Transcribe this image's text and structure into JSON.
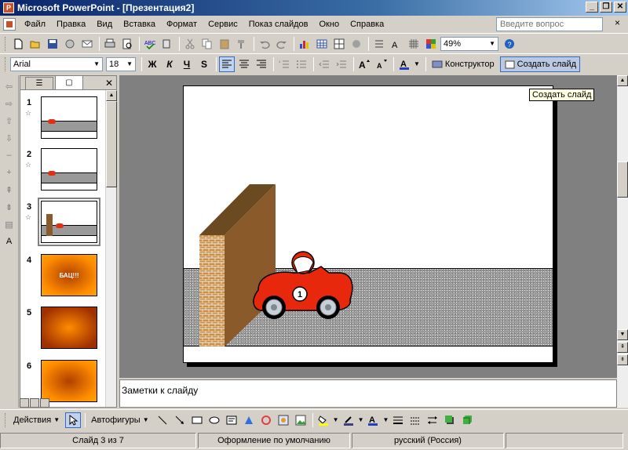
{
  "window": {
    "title": "Microsoft PowerPoint - [Презентация2]",
    "minimize": "_",
    "restore": "❐",
    "close": "✕"
  },
  "menu": {
    "items": [
      "Файл",
      "Правка",
      "Вид",
      "Вставка",
      "Формат",
      "Сервис",
      "Показ слайдов",
      "Окно",
      "Справка"
    ],
    "help_placeholder": "Введите вопрос",
    "close_doc": "×"
  },
  "standard_toolbar": {
    "zoom": "49%"
  },
  "formatting_toolbar": {
    "font": "Arial",
    "size": "18",
    "bold": "Ж",
    "italic": "К",
    "underline": "Ч",
    "shadow": "S",
    "designer": "Конструктор",
    "new_slide": "Создать слайд"
  },
  "tooltip": "Создать слайд",
  "slides": [
    {
      "number": "1",
      "kind": "road-car"
    },
    {
      "number": "2",
      "kind": "road-car"
    },
    {
      "number": "3",
      "kind": "road-wall"
    },
    {
      "number": "4",
      "kind": "orange",
      "title": "БАЦ!!!"
    },
    {
      "number": "5",
      "kind": "orange2"
    },
    {
      "number": "6",
      "kind": "orange"
    }
  ],
  "car_number": "1",
  "notes_placeholder": "Заметки к слайду",
  "drawing_toolbar": {
    "actions": "Действия",
    "autoshapes": "Автофигуры"
  },
  "status": {
    "slide": "Слайд 3 из 7",
    "design": "Оформление по умолчанию",
    "language": "русский (Россия)"
  },
  "colors": {
    "title_start": "#0a246a",
    "title_end": "#a6caf0",
    "car_red": "#e8280c",
    "wall_brown": "#8b5a2b"
  }
}
